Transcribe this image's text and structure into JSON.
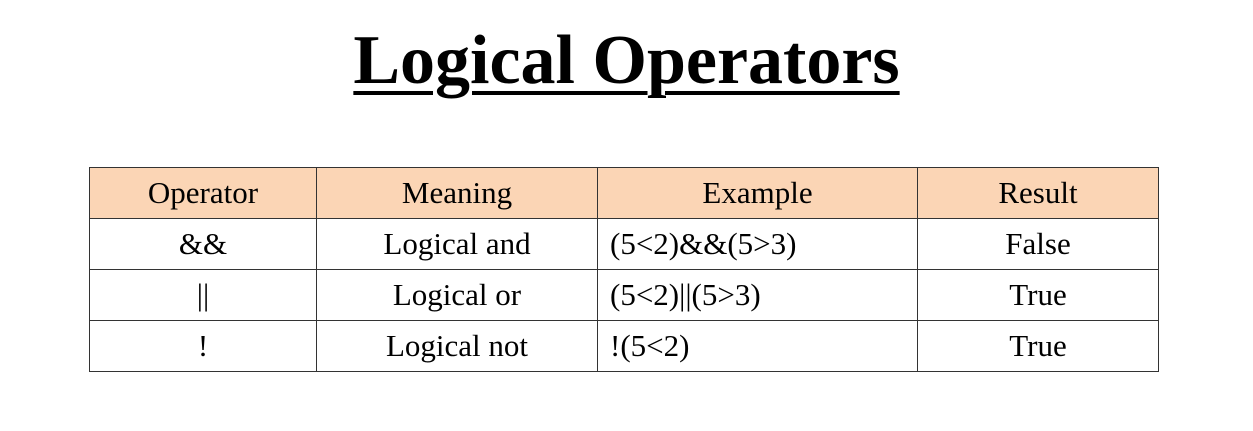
{
  "title": "Logical Operators",
  "table": {
    "headers": [
      "Operator",
      "Meaning",
      "Example",
      "Result"
    ],
    "rows": [
      {
        "operator": "&&",
        "meaning": "Logical and",
        "example": "(5<2)&&(5>3)",
        "result": "False"
      },
      {
        "operator": "||",
        "meaning": "Logical or",
        "example": "(5<2)||(5>3)",
        "result": "True"
      },
      {
        "operator": "!",
        "meaning": "Logical not",
        "example": "!(5<2)",
        "result": "True"
      }
    ]
  },
  "colors": {
    "header_background": "#fbd5b5",
    "border": "#333333",
    "text": "#000000"
  }
}
